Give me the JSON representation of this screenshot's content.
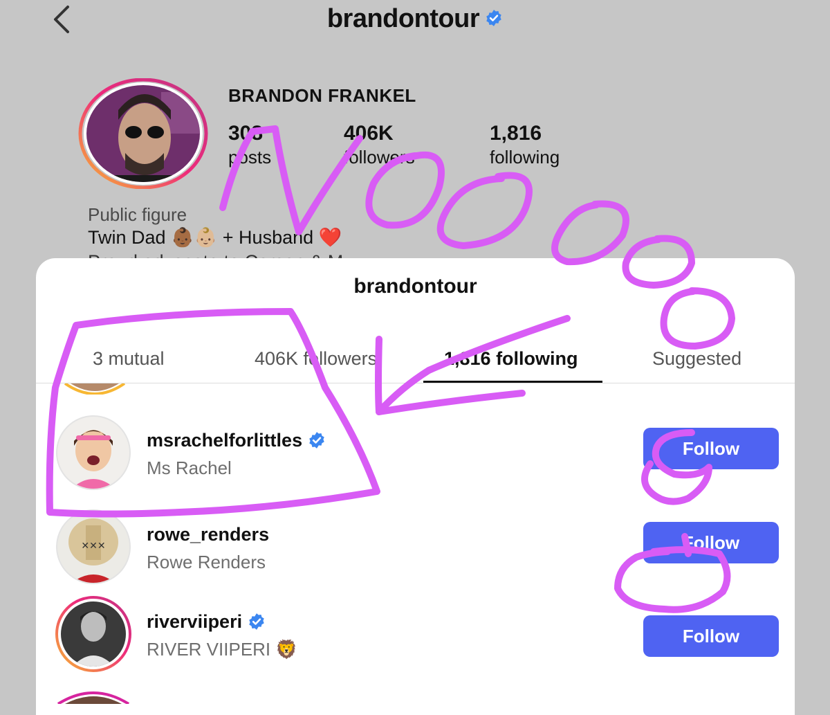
{
  "header": {
    "back_icon": "chevron-left-icon",
    "username": "brandontour",
    "verified_icon": "verified-badge-icon"
  },
  "profile": {
    "display_name": "BRANDON FRANKEL",
    "posts_count": "308",
    "posts_label": "posts",
    "followers_count": "406K",
    "followers_label": "followers",
    "following_count": "1,816",
    "following_label": "following",
    "category": "Public figure",
    "bio_line1": "Twin Dad 👶🏾👶🏼 + Husband ❤️",
    "bio_line2": "Proud advocate to Carson & M"
  },
  "sheet": {
    "title": "brandontour",
    "tabs": [
      {
        "label": "3 mutual",
        "active": false
      },
      {
        "label": "406K followers",
        "active": false
      },
      {
        "label": "1,816 following",
        "active": true
      },
      {
        "label": "Suggested",
        "active": false
      }
    ],
    "rows": [
      {
        "username": "msrachelforlittles",
        "full_name": "Ms Rachel",
        "verified": true,
        "button": "Follow"
      },
      {
        "username": "rowe_renders",
        "full_name": "Rowe Renders",
        "verified": false,
        "button": "Follow"
      },
      {
        "username": "riverviiperi",
        "full_name": "RIVER VIIPERI 🦁",
        "verified": true,
        "button": "Follow"
      }
    ]
  },
  "annotation": {
    "text": "Nooooo oo",
    "color": "#d85cf5"
  },
  "colors": {
    "follow_button": "#4f63f2",
    "verified": "#3b86f0",
    "story_ring_start": "#f7b733",
    "story_ring_end": "#d6249f"
  }
}
